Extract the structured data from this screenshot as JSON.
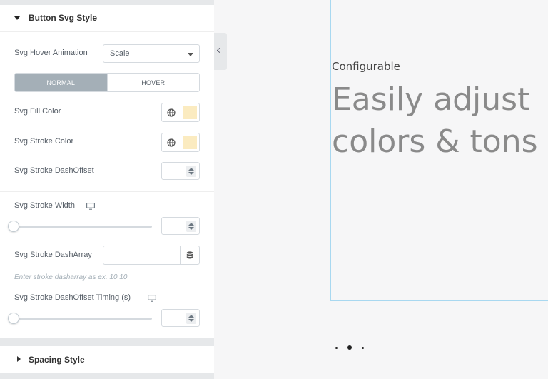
{
  "panel": {
    "section_title": "Button Svg Style",
    "hover_animation": {
      "label": "Svg Hover Animation",
      "value": "Scale"
    },
    "tabs": [
      {
        "label": "NORMAL",
        "active": true
      },
      {
        "label": "HOVER",
        "active": false
      }
    ],
    "fill_color": {
      "label": "Svg Fill Color",
      "swatch": "#fbebc0"
    },
    "stroke_color": {
      "label": "Svg Stroke Color",
      "swatch": "#fbebc0"
    },
    "stroke_dashoffset": {
      "label": "Svg Stroke DashOffset"
    },
    "stroke_width": {
      "label": "Svg Stroke Width",
      "slider_value": 0
    },
    "stroke_dasharray": {
      "label": "Svg Stroke DashArray",
      "help": "Enter stroke dasharray as ex. 10 10"
    },
    "dashoffset_timing": {
      "label": "Svg Stroke DashOffset Timing (s)",
      "slider_value": 0
    },
    "spacing_section_title": "Spacing Style"
  },
  "preview": {
    "eyebrow": "Configurable",
    "headline_line1": "Easily adjust",
    "headline_line2": "colors & tons"
  },
  "colors": {
    "panel_bg": "#e6e8ea",
    "accent_tab": "#a4afb7",
    "preview_border": "#a8d8f0"
  }
}
